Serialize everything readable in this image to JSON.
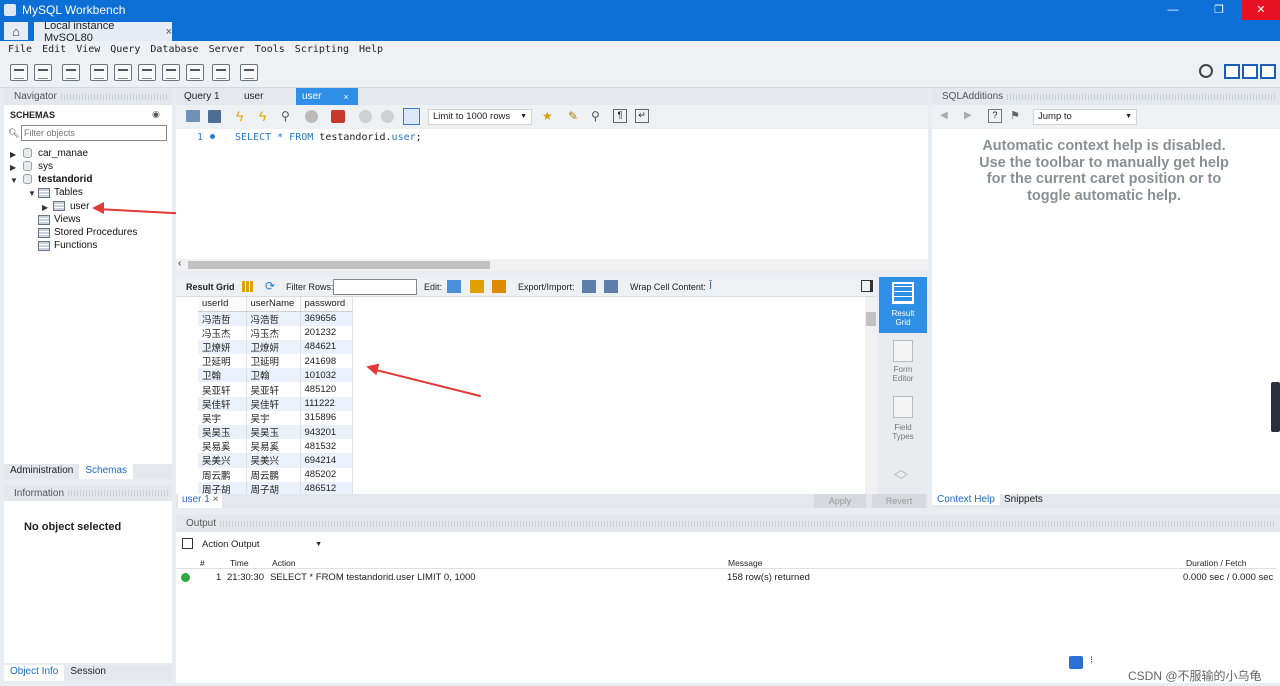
{
  "window": {
    "title": "MySQL Workbench",
    "connection_tab": "Local instance MySQL80",
    "close_glyph": "×"
  },
  "menu": [
    "File",
    "Edit",
    "View",
    "Query",
    "Database",
    "Server",
    "Tools",
    "Scripting",
    "Help"
  ],
  "navigator": {
    "header": "Navigator",
    "schemas_label": "SCHEMAS",
    "filter_placeholder": "Filter objects",
    "schemas": [
      "car_manae",
      "sys",
      "testandorid"
    ],
    "tables_label": "Tables",
    "table_user": "user",
    "views": "Views",
    "stored_procedures": "Stored Procedures",
    "functions": "Functions",
    "tabs": [
      "Administration",
      "Schemas"
    ]
  },
  "information": {
    "header": "Information",
    "no_object": "No object selected",
    "tabs": [
      "Object Info",
      "Session"
    ]
  },
  "editor": {
    "tabs": [
      "Query 1",
      "user",
      "user"
    ],
    "limit": "Limit to 1000 rows",
    "line_number": "1",
    "sql_keyword": "SELECT * FROM ",
    "sql_rest": "testandorid.",
    "sql_table": "user",
    "sql_end": ";"
  },
  "result": {
    "grid_label": "Result Grid",
    "filter_label": "Filter Rows:",
    "edit_label": "Edit:",
    "export_label": "Export/Import:",
    "wrap_label": "Wrap Cell Content:",
    "columns": [
      "userId",
      "userName",
      "password"
    ],
    "rows": [
      [
        "冯浩哲",
        "冯浩哲",
        "369656"
      ],
      [
        "冯玉杰",
        "冯玉杰",
        "201232"
      ],
      [
        "卫燎妍",
        "卫燎妍",
        "484621"
      ],
      [
        "卫延明",
        "卫延明",
        "241698"
      ],
      [
        "卫翰",
        "卫翰",
        "101032"
      ],
      [
        "吴亚轩",
        "吴亚轩",
        "485120"
      ],
      [
        "吴佳轩",
        "吴佳轩",
        "111222"
      ],
      [
        "吴宇",
        "吴宇",
        "315896"
      ],
      [
        "吴昊玉",
        "吴昊玉",
        "943201"
      ],
      [
        "吴易奚",
        "吴易奚",
        "481532"
      ],
      [
        "吴美兴",
        "吴美兴",
        "694214"
      ],
      [
        "周云鹏",
        "周云鹏",
        "485202"
      ],
      [
        "周子胡",
        "周子胡",
        "486512"
      ]
    ],
    "side_buttons": [
      [
        "Result",
        "Grid"
      ],
      [
        "Form",
        "Editor"
      ],
      [
        "Field",
        "Types"
      ]
    ],
    "bottom_tab": "user 1",
    "apply": "Apply",
    "revert": "Revert"
  },
  "sql_additions": {
    "header": "SQLAdditions",
    "jump_to": "Jump to",
    "help_text": "Automatic context help is disabled. Use the toolbar to manually get help for the current caret position or to toggle automatic help.",
    "tabs": [
      "Context Help",
      "Snippets"
    ]
  },
  "output": {
    "header": "Output",
    "mode": "Action Output",
    "columns": [
      "#",
      "Time",
      "Action",
      "Message",
      "Duration / Fetch"
    ],
    "row": {
      "num": "1",
      "time": "21:30:30",
      "action": "SELECT * FROM testandorid.user LIMIT 0, 1000",
      "message": "158 row(s) returned",
      "duration": "0.000 sec / 0.000 sec"
    }
  },
  "watermark": "CSDN @不服输的小乌龟",
  "colors": {
    "titlebar": "#0b6fd6",
    "active_tab": "#2f8fe6",
    "close_red": "#e81123",
    "arrow": "#e53935"
  }
}
